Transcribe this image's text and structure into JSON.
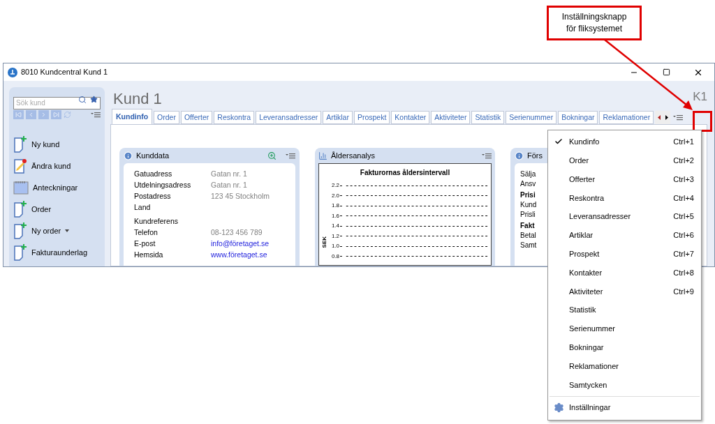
{
  "callout": {
    "lines": [
      "Inställningsknapp",
      "för fliksystemet"
    ]
  },
  "window": {
    "title": "8010 Kundcentral Kund 1"
  },
  "sidebar": {
    "search": {
      "placeholder": "Sök kund"
    },
    "actions": [
      {
        "label": "Ny kund",
        "kind": "new",
        "dropdown": false
      },
      {
        "label": "Ändra kund",
        "kind": "edit",
        "dropdown": false
      },
      {
        "label": "Anteckningar",
        "kind": "notes",
        "dropdown": false
      },
      {
        "label": "Order",
        "kind": "new",
        "dropdown": false
      },
      {
        "label": "Ny order",
        "kind": "new",
        "dropdown": true
      },
      {
        "label": "Fakturaunderlag",
        "kind": "new",
        "dropdown": false
      }
    ]
  },
  "heading": "Kund 1",
  "code": "K1",
  "tabs": [
    {
      "label": "Kundinfo",
      "selected": true
    },
    {
      "label": "Order",
      "selected": false
    },
    {
      "label": "Offerter",
      "selected": false
    },
    {
      "label": "Reskontra",
      "selected": false
    },
    {
      "label": "Leveransadresser",
      "selected": false
    },
    {
      "label": "Artiklar",
      "selected": false
    },
    {
      "label": "Prospekt",
      "selected": false
    },
    {
      "label": "Kontakter",
      "selected": false
    },
    {
      "label": "Aktiviteter",
      "selected": false
    },
    {
      "label": "Statistik",
      "selected": false
    },
    {
      "label": "Serienummer",
      "selected": false
    },
    {
      "label": "Bokningar",
      "selected": false
    },
    {
      "label": "Reklamationer",
      "selected": false
    }
  ],
  "kunddata": {
    "title": "Kunddata",
    "rows": [
      {
        "label": "Gatuadress",
        "value": "Gatan nr. 1",
        "kind": "text"
      },
      {
        "label": "Utdelningsadress",
        "value": "Gatan nr. 1",
        "kind": "text"
      },
      {
        "label": "Postadress",
        "value": "123 45 Stockholm",
        "kind": "text"
      },
      {
        "label": "Land",
        "kind": "text"
      },
      {
        "label": "Kundreferens",
        "kind": "gap"
      },
      {
        "label": "Telefon",
        "value": "08-123 456 789",
        "kind": "text"
      },
      {
        "label": "E-post",
        "value": "info@företaget.se",
        "kind": "link"
      },
      {
        "label": "Hemsida",
        "value": "www.företaget.se",
        "kind": "link"
      }
    ]
  },
  "aldersanalys": {
    "title": "Åldersanalys",
    "chart_title": "Fakturornas åldersintervall",
    "ylabel": "SEK",
    "yticks": [
      "2.2",
      "2.0",
      "1.8",
      "1.6",
      "1.4",
      "1.2",
      "1.0",
      "0.8"
    ]
  },
  "third_card": {
    "title": "Förs",
    "rows": [
      {
        "label": "Sälja",
        "bold": false
      },
      {
        "label": "Ansv",
        "bold": false
      },
      {
        "label": "Prisi",
        "bold": true
      },
      {
        "label": "Kund",
        "bold": false
      },
      {
        "label": "Prisli",
        "bold": false
      },
      {
        "label": "Fakt",
        "bold": true
      },
      {
        "label": "Betal",
        "bold": false
      },
      {
        "label": "Samt",
        "bold": false
      }
    ]
  },
  "menu": {
    "items": [
      {
        "label": "Kundinfo",
        "shortcut": "Ctrl+1",
        "checked": true,
        "kind": "tab"
      },
      {
        "label": "Order",
        "shortcut": "Ctrl+2",
        "checked": false,
        "kind": "tab"
      },
      {
        "label": "Offerter",
        "shortcut": "Ctrl+3",
        "checked": false,
        "kind": "tab"
      },
      {
        "label": "Reskontra",
        "shortcut": "Ctrl+4",
        "checked": false,
        "kind": "tab"
      },
      {
        "label": "Leveransadresser",
        "shortcut": "Ctrl+5",
        "checked": false,
        "kind": "tab"
      },
      {
        "label": "Artiklar",
        "shortcut": "Ctrl+6",
        "checked": false,
        "kind": "tab"
      },
      {
        "label": "Prospekt",
        "shortcut": "Ctrl+7",
        "checked": false,
        "kind": "tab"
      },
      {
        "label": "Kontakter",
        "shortcut": "Ctrl+8",
        "checked": false,
        "kind": "tab"
      },
      {
        "label": "Aktiviteter",
        "shortcut": "Ctrl+9",
        "checked": false,
        "kind": "tab"
      },
      {
        "label": "Statistik",
        "checked": false,
        "kind": "tab"
      },
      {
        "label": "Serienummer",
        "checked": false,
        "kind": "tab"
      },
      {
        "label": "Bokningar",
        "checked": false,
        "kind": "tab"
      },
      {
        "label": "Reklamationer",
        "checked": false,
        "kind": "tab"
      },
      {
        "label": "Samtycken",
        "checked": false,
        "kind": "tab"
      },
      {
        "label": "Inställningar",
        "kind": "settings"
      }
    ]
  }
}
